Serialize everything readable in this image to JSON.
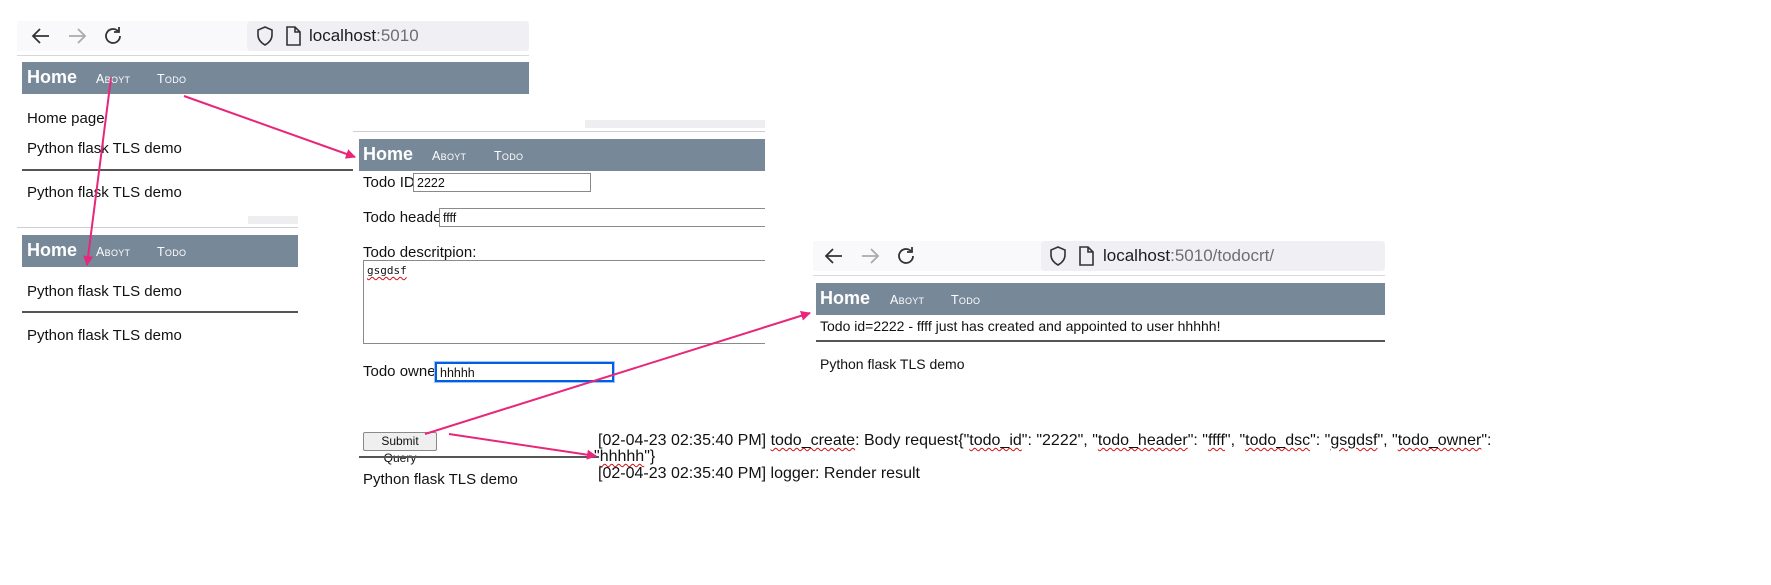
{
  "browser1": {
    "url_host": "localhost",
    "url_rest": ":5010"
  },
  "browser3": {
    "url_host": "localhost",
    "url_rest": ":5010/todocrt/"
  },
  "nav": {
    "home": "Home",
    "about": "Aboyt",
    "todo": "Todo"
  },
  "panel1": {
    "home_text": "Home page",
    "footer1": "Python flask TLS demo",
    "footer2": "Python flask TLS demo"
  },
  "panel1b": {
    "text1": "Python flask TLS demo",
    "text2": "Python flask TLS demo"
  },
  "form": {
    "id_label": "Todo ID:",
    "id_value": "2222",
    "header_label": "Todo header:",
    "header_value": "ffff",
    "desc_label": "Todo descritpion:",
    "desc_value": "gsgdsf",
    "owner_label": "Todo owner:",
    "owner_value": "hhhhh",
    "submit_label": "Submit Query",
    "footer": "Python flask TLS demo"
  },
  "result": {
    "message": "Todo id=2222 - ffff just has created and appointed to user hhhhh!",
    "footer": "Python flask TLS demo"
  },
  "log": {
    "line1_a": "[02-04-23 02:35:40 PM] ",
    "line1_b": "todo_create",
    "line1_c": ": Body request{\"",
    "line1_d": "todo_id",
    "line1_e": "\": \"2222\", \"",
    "line1_f": "todo_header",
    "line1_g": "\": \"",
    "line1_h": "ffff",
    "line1_i": "\", \"",
    "line1_j": "todo_dsc",
    "line1_k": "\": \"",
    "line1_l": "gsgdsf",
    "line1_m": "\", \"",
    "line1_n": "todo_owner",
    "line1_o": "\":",
    "line2_a": "\"",
    "line2_b": "hhhhh",
    "line2_c": "\"}",
    "line3": "[02-04-23 02:35:40 PM] logger: Render result"
  },
  "colors": {
    "navbar": "#778899",
    "arrow": "#e8267a",
    "focus": "#0060df"
  }
}
